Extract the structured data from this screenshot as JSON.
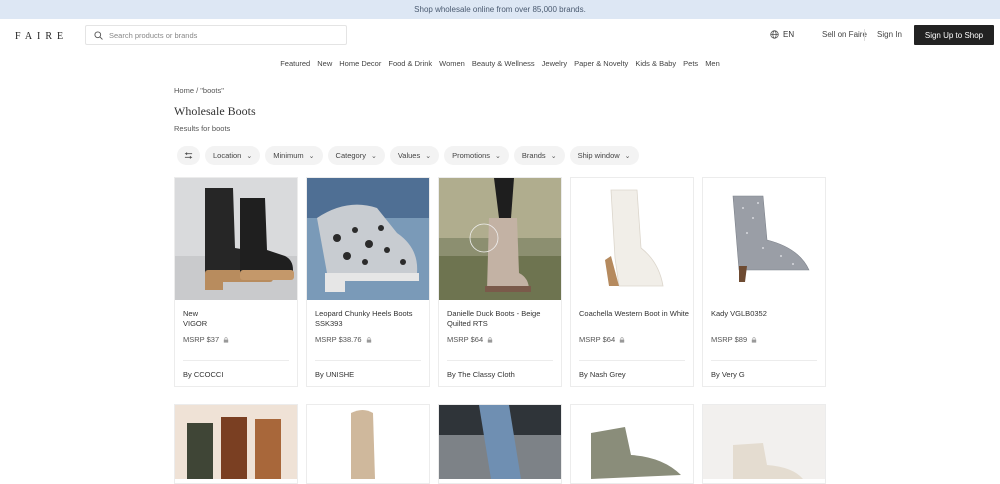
{
  "banner": {
    "text": "Shop wholesale online from over 85,000 brands."
  },
  "header": {
    "logo": "FAIRE",
    "search_placeholder": "Search products or brands",
    "lang": "EN",
    "sell": "Sell on Faire",
    "signin": "Sign In",
    "signup": "Sign Up to Shop"
  },
  "categories": [
    "Featured",
    "New",
    "Home Decor",
    "Food & Drink",
    "Women",
    "Beauty & Wellness",
    "Jewelry",
    "Paper & Novelty",
    "Kids & Baby",
    "Pets",
    "Men"
  ],
  "breadcrumb": "Home / \"boots\"",
  "page_title": "Wholesale Boots",
  "subtitle": "Results for boots",
  "filters": [
    "Location",
    "Minimum",
    "Category",
    "Values",
    "Promotions",
    "Brands",
    "Ship window"
  ],
  "products": [
    {
      "badge": "New",
      "name": "VIGOR",
      "msrp": "MSRP $37",
      "brand": "By CCOCCI",
      "image": "black-chelsea-boot"
    },
    {
      "badge": "",
      "name": "Leopard Chunky Heels Boots SSK393",
      "msrp": "MSRP $38.76",
      "brand": "By UNISHE",
      "image": "leopard-bootie"
    },
    {
      "badge": "",
      "name": "Danielle Duck Boots - Beige Quilted RTS",
      "msrp": "MSRP $64",
      "brand": "By The Classy Cloth",
      "image": "duck-boot"
    },
    {
      "badge": "",
      "name": "Coachella Western Boot in White",
      "msrp": "MSRP $64",
      "brand": "By Nash Grey",
      "image": "white-western-boot"
    },
    {
      "badge": "",
      "name": "Kady VGLB0352",
      "msrp": "MSRP $89",
      "brand": "By Very G",
      "image": "rhinestone-bootie"
    }
  ],
  "colors": {
    "banner_bg": "#dde7f4",
    "signup_bg": "#222222",
    "chip_bg": "#f3f3f3"
  }
}
